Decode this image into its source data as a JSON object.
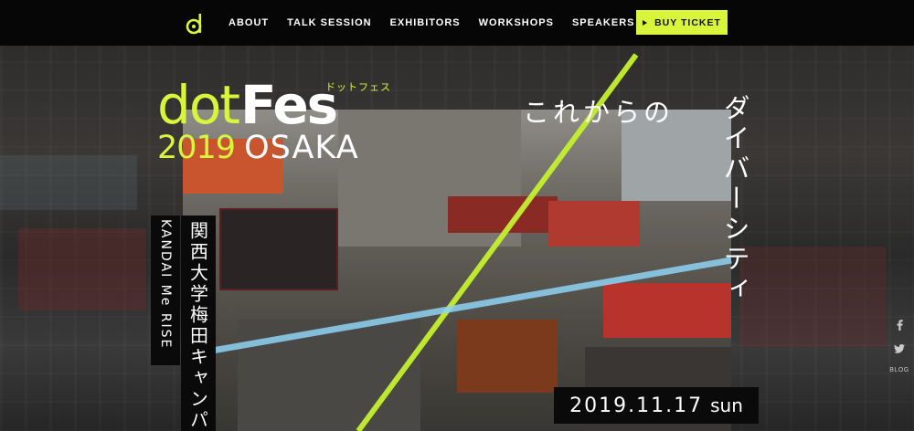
{
  "nav": {
    "logo_icon": "dotfes-d-logo-icon",
    "links": [
      {
        "label": "ABOUT"
      },
      {
        "label": "TALK SESSION"
      },
      {
        "label": "EXHIBITORS"
      },
      {
        "label": "WORKSHOPS"
      },
      {
        "label": "SPEAKERS"
      }
    ],
    "cta_label": "BUY TICKET"
  },
  "hero": {
    "logo": {
      "dot": "dot",
      "fes": "Fes",
      "kana": "ドットフェス",
      "year": "2019",
      "city": "OSAKA"
    },
    "tagline_row": "これからの",
    "tagline_vertical": "ダイバーシティ",
    "venue_jp": "関西大学梅田キャンパ",
    "venue_en": "KANDAI Me RISE",
    "date": "2019.11.17",
    "day": "sun"
  },
  "social": {
    "facebook_icon": "facebook-icon",
    "twitter_icon": "twitter-icon",
    "blog_label": "BLOG"
  },
  "colors": {
    "accent": "#d9f53b",
    "nav_bg": "#060606",
    "line_blue": "#8fd3f4"
  }
}
